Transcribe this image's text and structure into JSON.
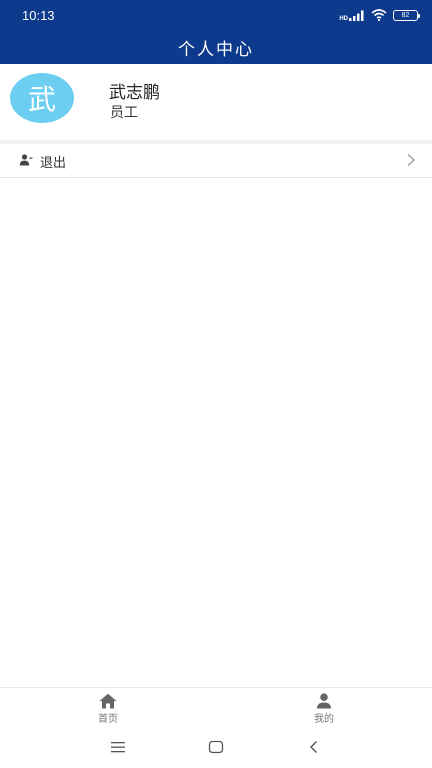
{
  "status_bar": {
    "time": "10:13",
    "hd_label": "HD",
    "battery": "82",
    "icons": [
      "signal-icon",
      "wifi-icon",
      "battery-icon"
    ]
  },
  "header": {
    "title": "个人中心"
  },
  "profile": {
    "avatar_text": "武",
    "avatar_color": "#6ccff1",
    "name": "武志鹏",
    "role": "员工"
  },
  "menu": {
    "items": [
      {
        "label": "退出",
        "icon": "user-exit-icon"
      }
    ]
  },
  "tab_bar": {
    "tabs": [
      {
        "label": "首页",
        "icon": "home-icon"
      },
      {
        "label": "我的",
        "icon": "person-icon"
      }
    ]
  },
  "colors": {
    "header_bg": "#0d3a8c",
    "avatar_bg": "#6ccff1"
  }
}
